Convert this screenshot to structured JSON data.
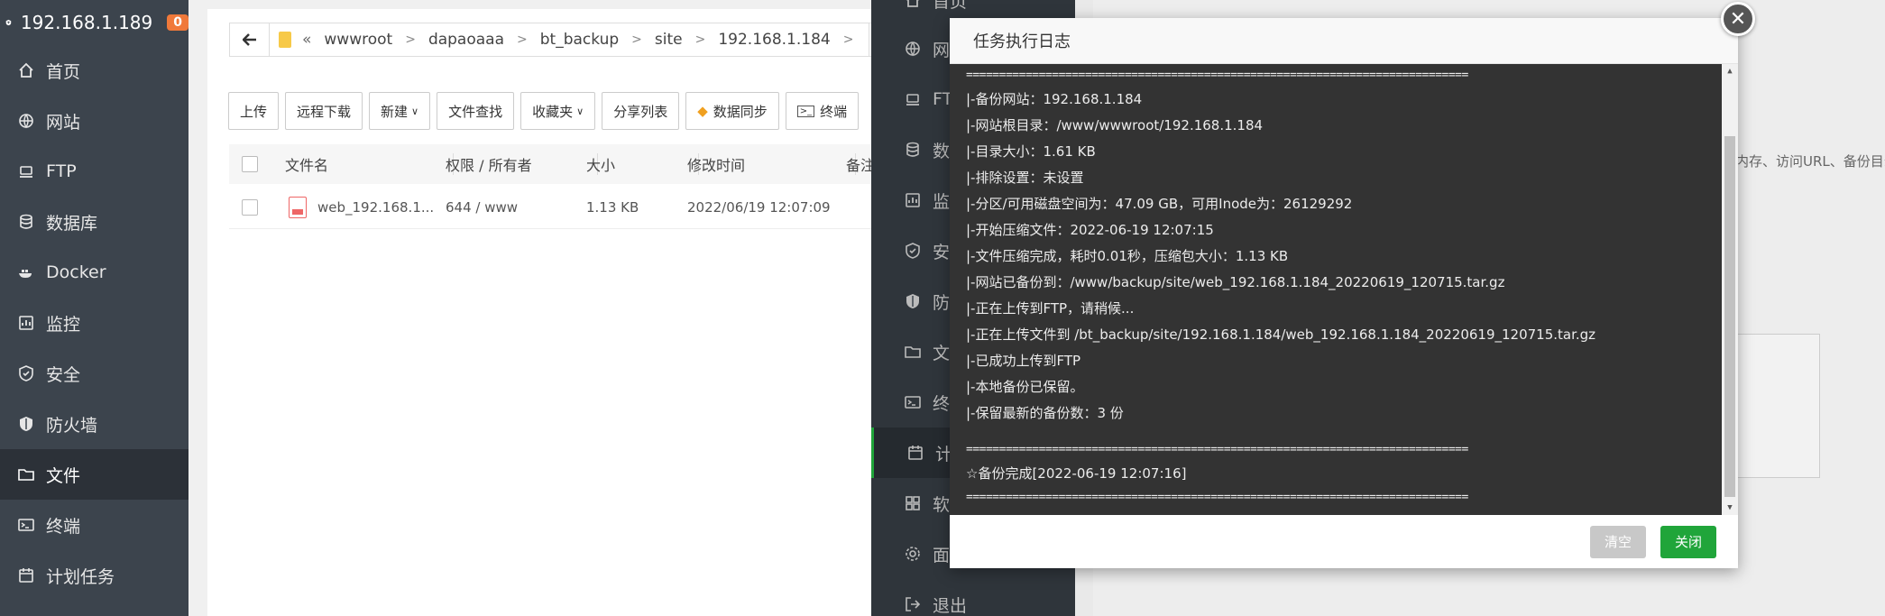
{
  "sidebar": {
    "host": "192.168.1.189",
    "badge": "0",
    "items": [
      {
        "label": "首页",
        "icon": "home-icon"
      },
      {
        "label": "网站",
        "icon": "globe-icon"
      },
      {
        "label": "FTP",
        "icon": "ftp-icon"
      },
      {
        "label": "数据库",
        "icon": "database-icon"
      },
      {
        "label": "Docker",
        "icon": "docker-icon"
      },
      {
        "label": "监控",
        "icon": "monitor-icon"
      },
      {
        "label": "安全",
        "icon": "shield-icon"
      },
      {
        "label": "防火墙",
        "icon": "firewall-icon"
      },
      {
        "label": "文件",
        "icon": "folder-icon"
      },
      {
        "label": "终端",
        "icon": "terminal-icon"
      },
      {
        "label": "计划任务",
        "icon": "calendar-icon"
      }
    ]
  },
  "files": {
    "path": [
      "wwwroot",
      "dapaoaaa",
      "bt_backup",
      "site",
      "192.168.1.184"
    ],
    "toolbar": [
      "上传",
      "远程下载",
      "新建",
      "文件查找",
      "收藏夹",
      "分享列表",
      "数据同步",
      "终端"
    ],
    "headers": {
      "name": "文件名",
      "perm": "权限 / 所有者",
      "size": "大小",
      "mtime": "修改时间",
      "extra": "备注"
    },
    "rows": [
      {
        "name": "web_192.168.1...",
        "perm": "644 / www",
        "size": "1.13 KB",
        "mtime": "2022/06/19 12:07:09"
      }
    ]
  },
  "rightnav": {
    "items": [
      {
        "label": "首页",
        "icon": "home-icon"
      },
      {
        "label": "网",
        "icon": "globe-icon"
      },
      {
        "label": "FT",
        "icon": "ftp-icon"
      },
      {
        "label": "数",
        "icon": "database-icon"
      },
      {
        "label": "监",
        "icon": "monitor-icon"
      },
      {
        "label": "安",
        "icon": "shield-icon"
      },
      {
        "label": "防",
        "icon": "firewall-icon"
      },
      {
        "label": "文",
        "icon": "folder-icon"
      },
      {
        "label": "终",
        "icon": "terminal-icon"
      },
      {
        "label": "计",
        "icon": "calendar-icon"
      },
      {
        "label": "软",
        "icon": "apps-icon"
      },
      {
        "label": "面",
        "icon": "gear-icon"
      },
      {
        "label": "退出",
        "icon": "logout-icon"
      }
    ],
    "panel_text": "内存、访问URL、备份目录"
  },
  "modal": {
    "title": "任务执行日志",
    "separator": "============================================================================",
    "lines": [
      "|-备份网站：192.168.1.184",
      "|-网站根目录：/www/wwwroot/192.168.1.184",
      "|-目录大小：1.61 KB",
      "|-排除设置：未设置",
      "|-分区/可用磁盘空间为：47.09 GB，可用Inode为：26129292",
      "|-开始压缩文件：2022-06-19 12:07:15",
      "|-文件压缩完成，耗时0.01秒，压缩包大小：1.13 KB",
      "|-网站已备份到：/www/backup/site/web_192.168.1.184_20220619_120715.tar.gz",
      "|-正在上传到FTP，请稍候...",
      "|-正在上传文件到 /bt_backup/site/192.168.1.184/web_192.168.1.184_20220619_120715.tar.gz",
      "|-已成功上传到FTP",
      "|-本地备份已保留。",
      "|-保留最新的备份数：3 份"
    ],
    "done": "☆备份完成[2022-06-19 12:07:16]",
    "btn_clear": "清空",
    "btn_close": "关闭"
  }
}
